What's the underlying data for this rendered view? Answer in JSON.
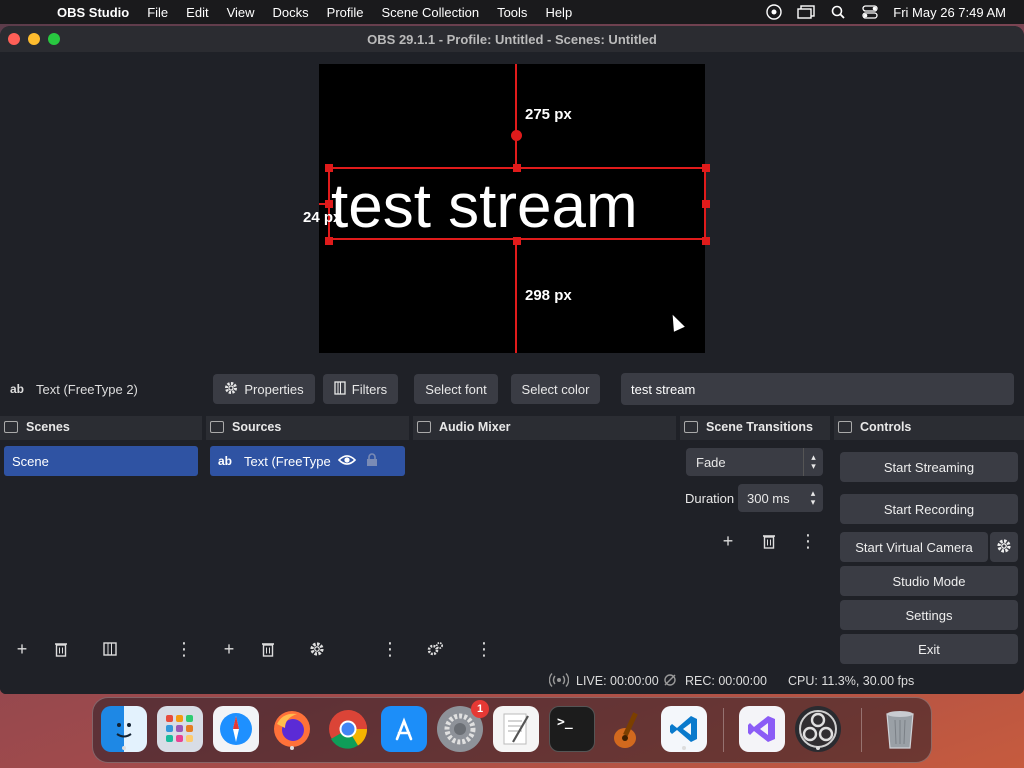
{
  "menubar": {
    "app_name": "OBS Studio",
    "items": [
      "File",
      "Edit",
      "View",
      "Docks",
      "Profile",
      "Scene Collection",
      "Tools",
      "Help"
    ],
    "clock": "Fri May 26  7:49 AM"
  },
  "window": {
    "title": "OBS 29.1.1 - Profile: Untitled - Scenes: Untitled"
  },
  "preview": {
    "text": "test stream",
    "top_distance": "275 px",
    "left_distance": "24 px",
    "bottom_distance": "298 px"
  },
  "toolbar": {
    "source_icon": "ab",
    "source_name": "Text (FreeType 2)",
    "properties_label": "Properties",
    "filters_label": "Filters",
    "select_font_label": "Select font",
    "select_color_label": "Select color",
    "text_value": "test stream"
  },
  "scenes": {
    "title": "Scenes",
    "items": [
      "Scene"
    ]
  },
  "sources": {
    "title": "Sources",
    "items": [
      {
        "icon": "ab",
        "label": "Text (FreeType"
      }
    ]
  },
  "audio_mixer": {
    "title": "Audio Mixer"
  },
  "transitions": {
    "title": "Scene Transitions",
    "selected": "Fade",
    "duration_label": "Duration",
    "duration_value": "300 ms"
  },
  "controls": {
    "title": "Controls",
    "start_streaming": "Start Streaming",
    "start_recording": "Start Recording",
    "start_virtual_camera": "Start Virtual Camera",
    "studio_mode": "Studio Mode",
    "settings": "Settings",
    "exit": "Exit"
  },
  "status": {
    "live": "LIVE: 00:00:00",
    "rec": "REC: 00:00:00",
    "cpu": "CPU: 11.3%, 30.00 fps"
  },
  "dock_badge": "1",
  "colors": {
    "accent": "#2f53a3",
    "selection": "#e01b1b"
  }
}
